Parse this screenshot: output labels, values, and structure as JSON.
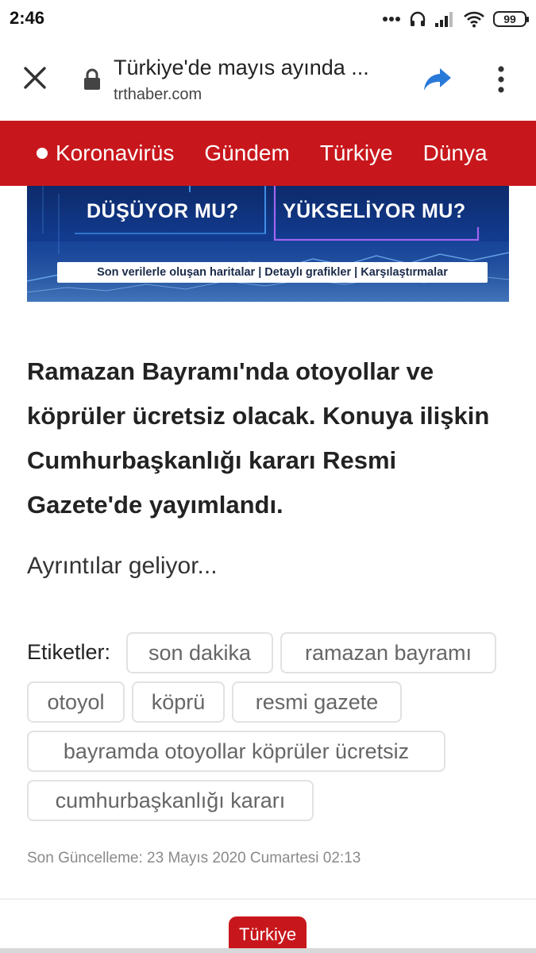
{
  "status_bar": {
    "time": "2:46",
    "battery": "99",
    "icons": [
      "more-dots-icon",
      "headphones-icon",
      "signal-icon",
      "wifi-icon",
      "battery-icon"
    ]
  },
  "browser": {
    "page_title": "Türkiye'de mayıs ayında ...",
    "url": "trthaber.com",
    "icons": [
      "close-icon",
      "lock-icon",
      "share-icon",
      "more-vert-icon"
    ]
  },
  "nav": {
    "items": [
      "Koronavirüs",
      "Gündem",
      "Türkiye",
      "Dünya"
    ],
    "background": "#c8171c"
  },
  "banner": {
    "left_title": "DÜŞÜYOR MU?",
    "right_title": "YÜKSELİYOR MU?",
    "strip": "Son verilerle oluşan haritalar | Detaylı grafikler | Karşılaştırmalar"
  },
  "article": {
    "headline": "Ramazan Bayramı'nda otoyollar ve köprüler ücretsiz olacak. Konuya ilişkin Cumhurbaşkanlığı kararı Resmi Gazete'de yayımlandı.",
    "body": "Ayrıntılar geliyor...",
    "tags_label": "Etiketler:",
    "tags": [
      "son dakika",
      "ramazan bayramı",
      "otoyol",
      "köprü",
      "resmi gazete",
      "bayramda otoyollar köprüler ücretsiz",
      "cumhurbaşkanlığı kararı"
    ],
    "updated": "Son Güncelleme: 23 Mayıs 2020 Cumartesi 02:13",
    "category": "Türkiye"
  },
  "colors": {
    "accent": "#c8171c",
    "tag_border": "#e2e2e2",
    "muted_text": "#8a8a8a"
  }
}
